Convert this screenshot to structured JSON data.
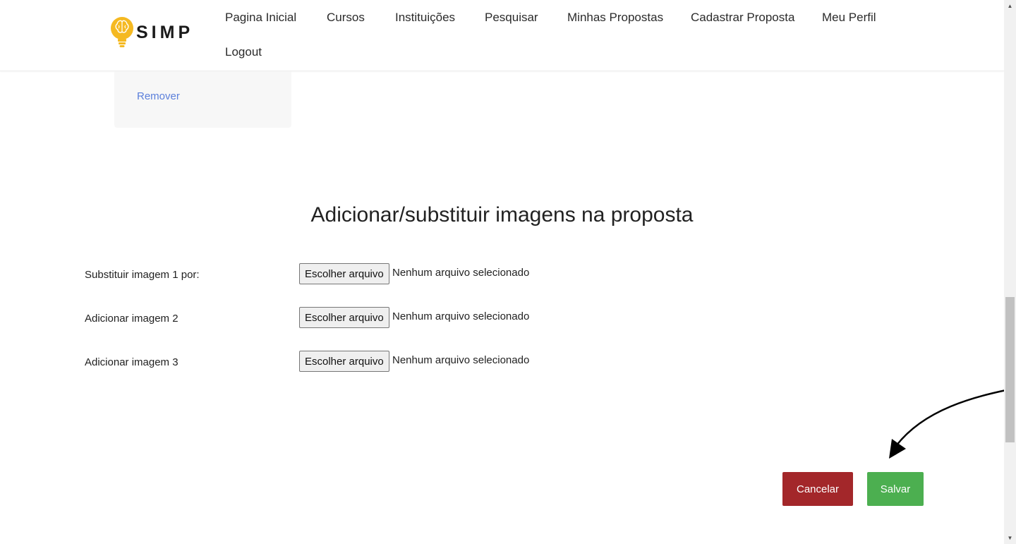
{
  "header": {
    "logo_text": "SIMP",
    "nav": [
      {
        "label": "Pagina Inicial"
      },
      {
        "label": "Cursos"
      },
      {
        "label": "Instituições"
      },
      {
        "label": "Pesquisar"
      },
      {
        "label": "Minhas Propostas"
      },
      {
        "label": "Cadastrar Proposta"
      },
      {
        "label": "Meu Perfil"
      },
      {
        "label": "Logout"
      }
    ]
  },
  "card": {
    "remover_label": "Remover"
  },
  "section": {
    "title": "Adicionar/substituir imagens na proposta"
  },
  "rows": [
    {
      "label": "Substituir imagem 1 por:",
      "button": "Escolher arquivo",
      "status": "Nenhum arquivo selecionado"
    },
    {
      "label": "Adicionar imagem 2",
      "button": "Escolher arquivo",
      "status": "Nenhum arquivo selecionado"
    },
    {
      "label": "Adicionar imagem 3",
      "button": "Escolher arquivo",
      "status": "Nenhum arquivo selecionado"
    }
  ],
  "actions": {
    "cancel_label": "Cancelar",
    "save_label": "Salvar"
  },
  "colors": {
    "cancel": "#a3272a",
    "save": "#4caf50",
    "link": "#5b7fdb",
    "logo_accent": "#f5b921"
  },
  "icons": {
    "logo": "lightbulb-brain-icon",
    "annotation": "curved-arrow-icon"
  }
}
